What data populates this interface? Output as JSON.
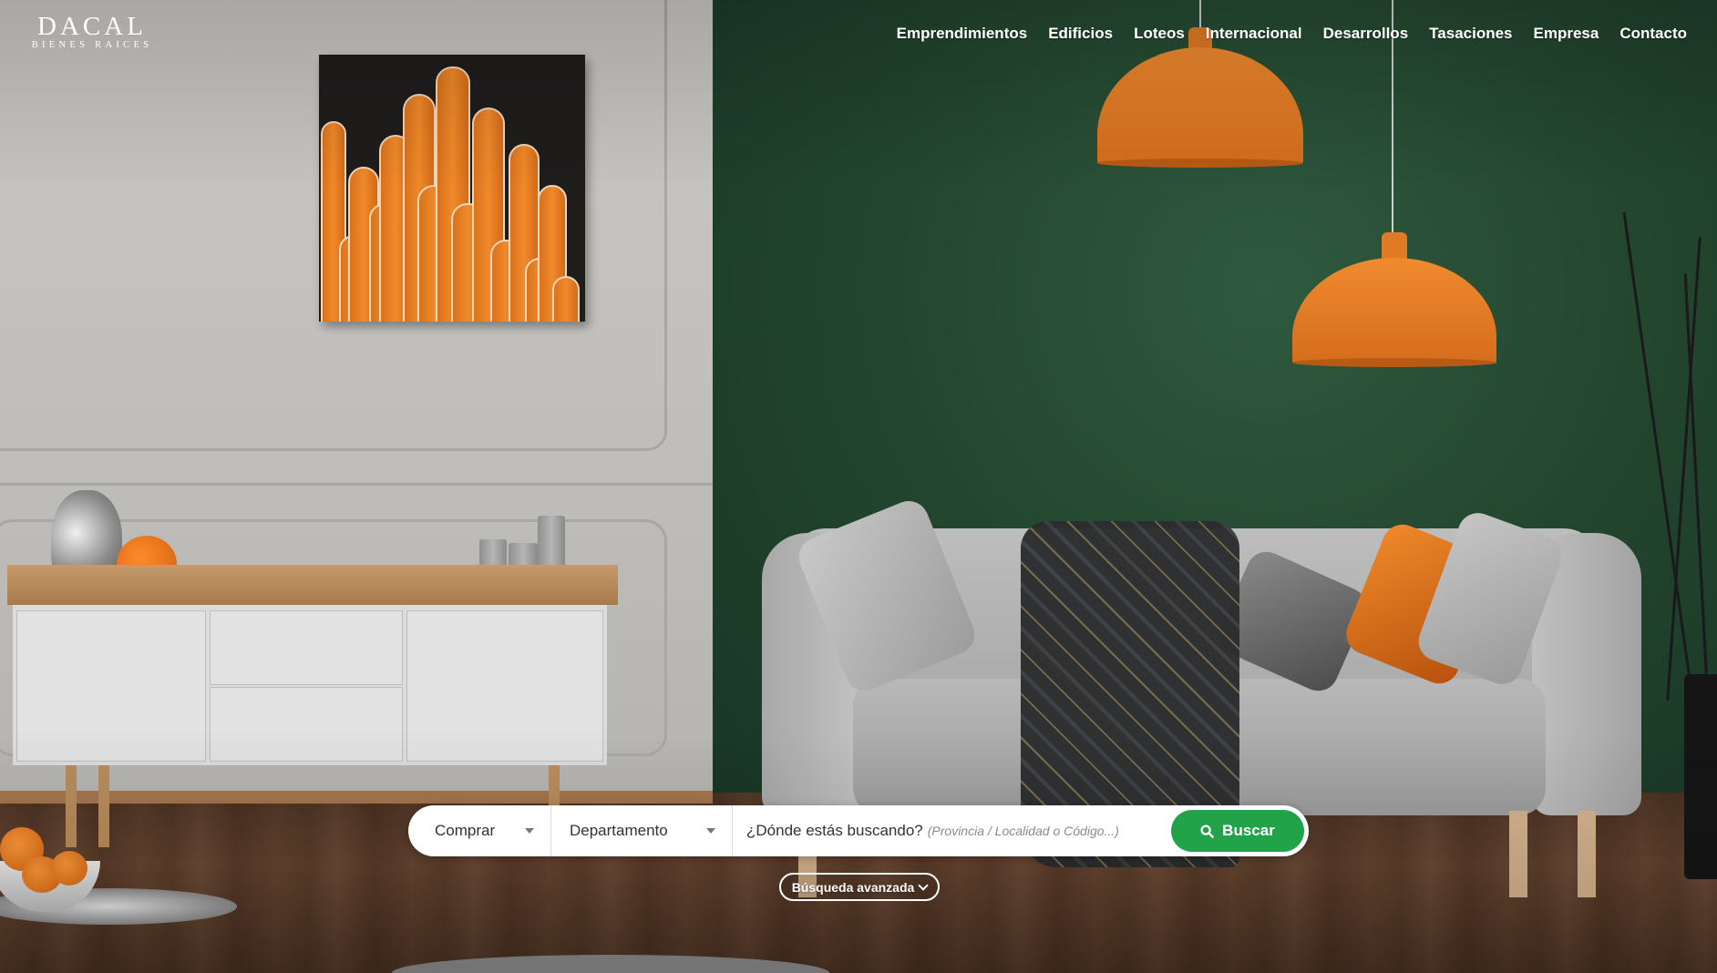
{
  "brand": {
    "name": "DACAL",
    "tagline": "BIENES RAICES"
  },
  "nav": {
    "items": [
      "Emprendimientos",
      "Edificios",
      "Loteos",
      "Internacional",
      "Desarrollos",
      "Tasaciones",
      "Empresa",
      "Contacto"
    ]
  },
  "search": {
    "operation": "Comprar",
    "property_type": "Departamento",
    "location_label": "¿Dónde estás buscando?",
    "location_hint": "(Provincia / Localidad o Código...)",
    "submit_label": "Buscar",
    "advanced_label": "Búsqueda avanzada"
  },
  "colors": {
    "accent": "#22a34a",
    "text_on_dark": "#ffffff"
  },
  "icons": [
    "search-icon",
    "caret-down-icon",
    "chevron-down-icon"
  ]
}
